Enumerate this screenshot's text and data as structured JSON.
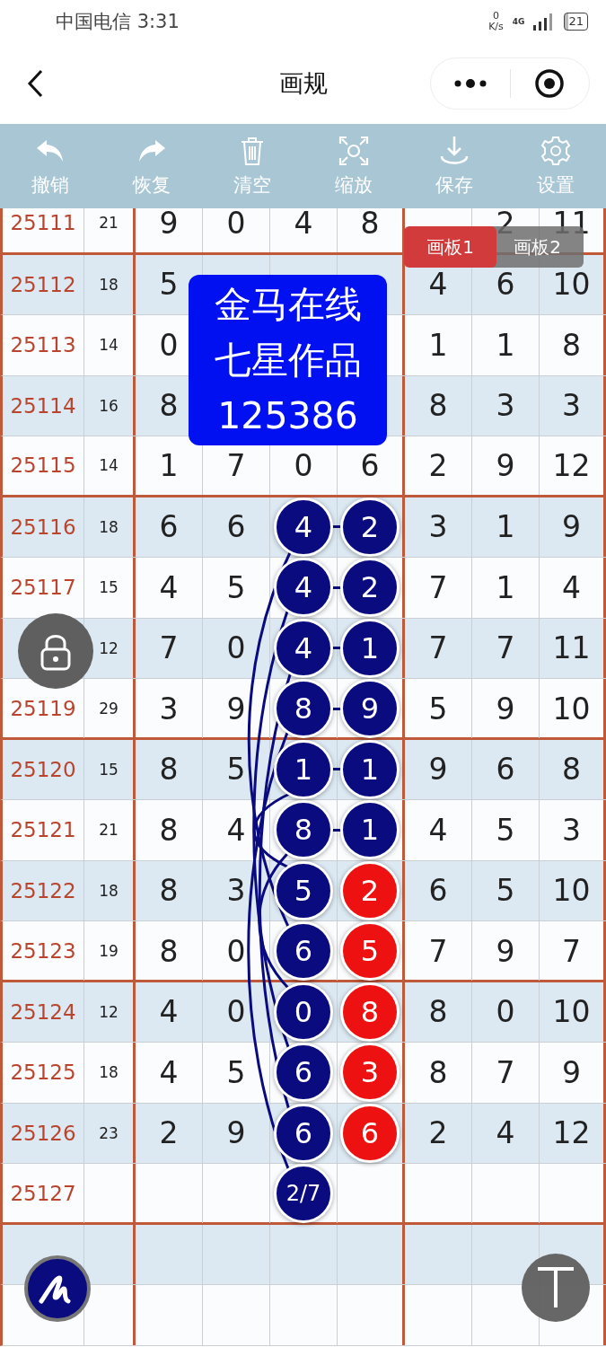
{
  "status_bar": {
    "carrier_time": "中国电信 3:31",
    "speed_value": "0",
    "speed_unit": "K/s",
    "network": "4G",
    "battery": "21"
  },
  "nav": {
    "title": "画规"
  },
  "toolbar": [
    {
      "label": "撤销",
      "kind": "undo"
    },
    {
      "label": "恢复",
      "kind": "redo"
    },
    {
      "label": "清空",
      "kind": "clear"
    },
    {
      "label": "缩放",
      "kind": "zoom"
    },
    {
      "label": "保存",
      "kind": "save"
    },
    {
      "label": "设置",
      "kind": "settings"
    }
  ],
  "board_tabs": [
    {
      "label": "画板1",
      "selected": true
    },
    {
      "label": "画板2",
      "selected": false
    }
  ],
  "banner": {
    "lines": [
      "金马在线",
      "七星作品",
      "125386"
    ]
  },
  "rows": [
    {
      "period": "25111",
      "sum": "21",
      "cells": [
        "9",
        "0",
        "4",
        "8",
        null,
        "2",
        "11"
      ]
    },
    {
      "period": "25112",
      "sum": "18",
      "cells": [
        "5",
        null,
        null,
        null,
        "4",
        "6",
        "10"
      ]
    },
    {
      "period": "25113",
      "sum": "14",
      "cells": [
        "0",
        null,
        null,
        null,
        "1",
        "1",
        "8"
      ]
    },
    {
      "period": "25114",
      "sum": "16",
      "cells": [
        "8",
        null,
        null,
        null,
        "8",
        "3",
        "3"
      ]
    },
    {
      "period": "25115",
      "sum": "14",
      "cells": [
        "1",
        "7",
        "0",
        "6",
        "2",
        "9",
        "12"
      ]
    },
    {
      "period": "25116",
      "sum": "18",
      "linked": true,
      "cells": [
        "6",
        "6",
        {
          "kind": "ball",
          "text": "4",
          "color": "#0b0b80"
        },
        {
          "kind": "ball",
          "text": "2",
          "color": "#0b0b80"
        },
        "3",
        "1",
        "9"
      ]
    },
    {
      "period": "25117",
      "sum": "15",
      "linked": true,
      "cells": [
        "4",
        "5",
        {
          "kind": "ball",
          "text": "4",
          "color": "#0b0b80"
        },
        {
          "kind": "ball",
          "text": "2",
          "color": "#0b0b80"
        },
        "7",
        "1",
        "4"
      ]
    },
    {
      "sum": "12",
      "linked": true,
      "cells": [
        "7",
        "0",
        {
          "kind": "ball",
          "text": "4",
          "color": "#0b0b80"
        },
        {
          "kind": "ball",
          "text": "1",
          "color": "#0b0b80"
        },
        "7",
        "7",
        "11"
      ]
    },
    {
      "period": "25119",
      "sum": "29",
      "linked": true,
      "cells": [
        "3",
        "9",
        {
          "kind": "ball",
          "text": "8",
          "color": "#0b0b80"
        },
        {
          "kind": "ball",
          "text": "9",
          "color": "#0b0b80"
        },
        "5",
        "9",
        "10"
      ]
    },
    {
      "period": "25120",
      "sum": "15",
      "linked": true,
      "cells": [
        "8",
        "5",
        {
          "kind": "ball",
          "text": "1",
          "color": "#0b0b80"
        },
        {
          "kind": "ball",
          "text": "1",
          "color": "#0b0b80"
        },
        "9",
        "6",
        "8"
      ]
    },
    {
      "period": "25121",
      "sum": "21",
      "linked": true,
      "cells": [
        "8",
        "4",
        {
          "kind": "ball",
          "text": "8",
          "color": "#0b0b80"
        },
        {
          "kind": "ball",
          "text": "1",
          "color": "#0b0b80"
        },
        "4",
        "5",
        "3"
      ]
    },
    {
      "period": "25122",
      "sum": "18",
      "cells": [
        "8",
        "3",
        {
          "kind": "ball",
          "text": "5",
          "color": "#0b0b80"
        },
        {
          "kind": "ball",
          "text": "2",
          "color": "#ee1111"
        },
        "6",
        "5",
        "10"
      ]
    },
    {
      "period": "25123",
      "sum": "19",
      "cells": [
        "8",
        "0",
        {
          "kind": "ball",
          "text": "6",
          "color": "#0b0b80"
        },
        {
          "kind": "ball",
          "text": "5",
          "color": "#ee1111"
        },
        "7",
        "9",
        "7"
      ]
    },
    {
      "period": "25124",
      "sum": "12",
      "cells": [
        "4",
        "0",
        {
          "kind": "ball",
          "text": "0",
          "color": "#0b0b80"
        },
        {
          "kind": "ball",
          "text": "8",
          "color": "#ee1111"
        },
        "8",
        "0",
        "10"
      ]
    },
    {
      "period": "25125",
      "sum": "18",
      "cells": [
        "4",
        "5",
        {
          "kind": "ball",
          "text": "6",
          "color": "#0b0b80"
        },
        {
          "kind": "ball",
          "text": "3",
          "color": "#ee1111"
        },
        "8",
        "7",
        "9"
      ]
    },
    {
      "period": "25126",
      "sum": "23",
      "cells": [
        "2",
        "9",
        {
          "kind": "ball",
          "text": "6",
          "color": "#0b0b80"
        },
        {
          "kind": "ball",
          "text": "6",
          "color": "#ee1111"
        },
        "2",
        "4",
        "12"
      ]
    },
    {
      "period": "25127",
      "cells": [
        null,
        null,
        {
          "kind": "ball",
          "text": "2/7",
          "color": "#0b0b80"
        },
        null,
        null,
        null,
        null
      ]
    },
    {
      "cells": [
        null,
        null,
        null,
        null,
        null,
        null,
        null
      ]
    },
    {
      "cells": [
        null,
        null,
        null,
        null,
        null,
        null,
        null
      ]
    }
  ]
}
